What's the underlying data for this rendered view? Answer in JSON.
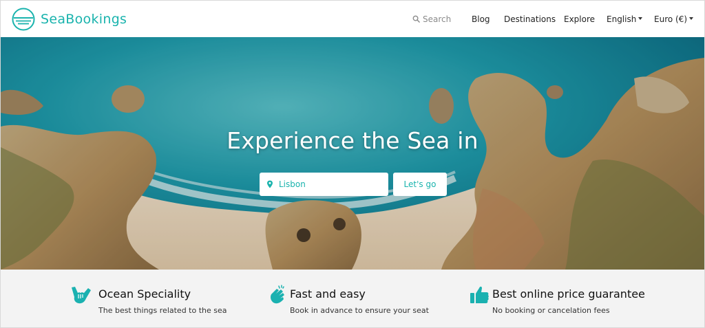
{
  "brand": {
    "name": "SeaBookings",
    "color": "#19b3ad"
  },
  "nav": {
    "search_label": "Search",
    "blog": "Blog",
    "destinations": "Destinations",
    "explore": "Explore",
    "language": "English",
    "currency": "Euro (€)"
  },
  "hero": {
    "title": "Experience the Sea in",
    "location_value": "Lisbon",
    "cta_label": "Let's go"
  },
  "features": [
    {
      "icon": "shaka-hand-icon",
      "title": "Ocean Speciality",
      "subtitle": "The best things related to the sea"
    },
    {
      "icon": "clapping-hands-icon",
      "title": "Fast and easy",
      "subtitle": "Book in advance to ensure your seat"
    },
    {
      "icon": "thumbs-up-icon",
      "title": "Best online price guarantee",
      "subtitle": "No booking or cancelation fees"
    }
  ]
}
